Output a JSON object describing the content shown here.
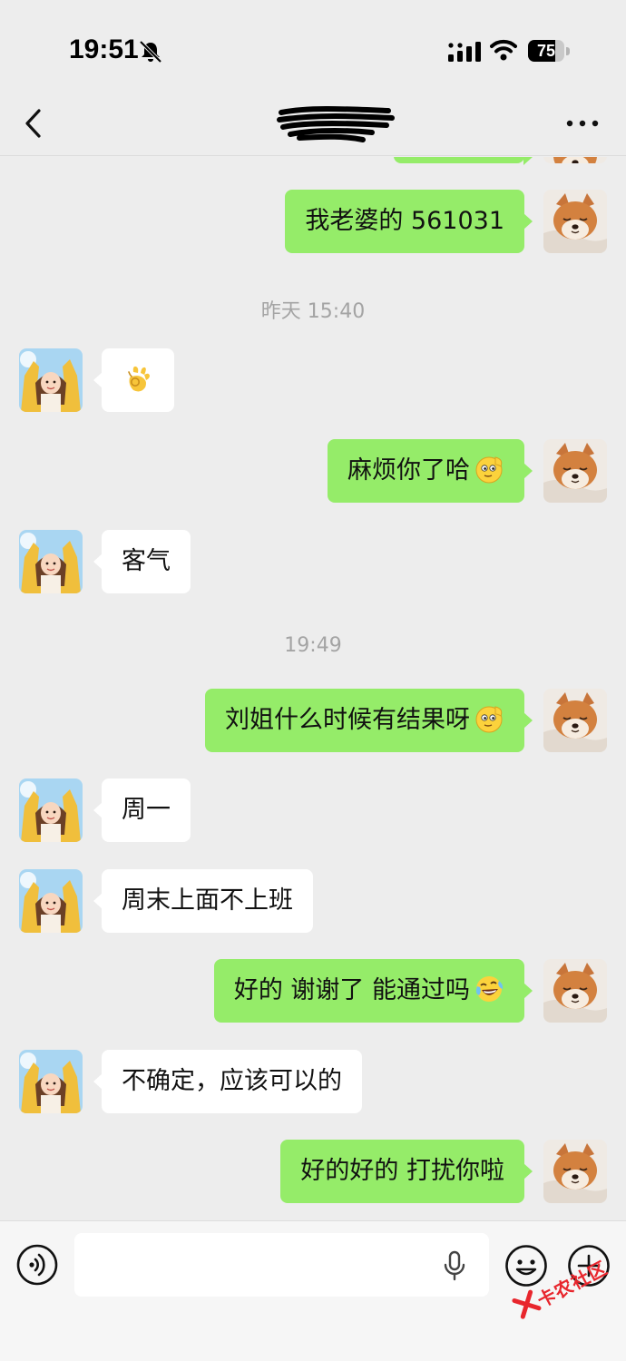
{
  "status_bar": {
    "time": "19:51",
    "battery_level": "75",
    "battery_fraction": 0.75
  },
  "nav": {
    "title_redacted": true
  },
  "messages": [
    {
      "side": "sent",
      "text": "我老婆的 561031",
      "emoji": null
    },
    {
      "type": "timestamp",
      "text": "昨天 15:40"
    },
    {
      "side": "recv",
      "text": "",
      "emoji": "ok-hand"
    },
    {
      "side": "sent",
      "text": "麻烦你了哈",
      "emoji": "salute"
    },
    {
      "side": "recv",
      "text": "客气",
      "emoji": null
    },
    {
      "type": "timestamp",
      "text": "19:49"
    },
    {
      "side": "sent",
      "text": "刘姐什么时候有结果呀",
      "emoji": "salute"
    },
    {
      "side": "recv",
      "text": "周一",
      "emoji": null
    },
    {
      "side": "recv",
      "text": "周末上面不上班",
      "emoji": null
    },
    {
      "side": "sent",
      "text": "好的 谢谢了 能通过吗",
      "emoji": "laugh-cry"
    },
    {
      "side": "recv",
      "text": "不确定，应该可以的",
      "emoji": null
    },
    {
      "side": "sent",
      "text": "好的好的 打扰你啦",
      "emoji": null
    }
  ],
  "input_bar": {
    "placeholder": ""
  },
  "watermark": {
    "text": "卡农社区"
  },
  "colors": {
    "sent_bubble": "#95ec69",
    "recv_bubble": "#ffffff",
    "background": "#ededed",
    "watermark": "#e8262d"
  }
}
